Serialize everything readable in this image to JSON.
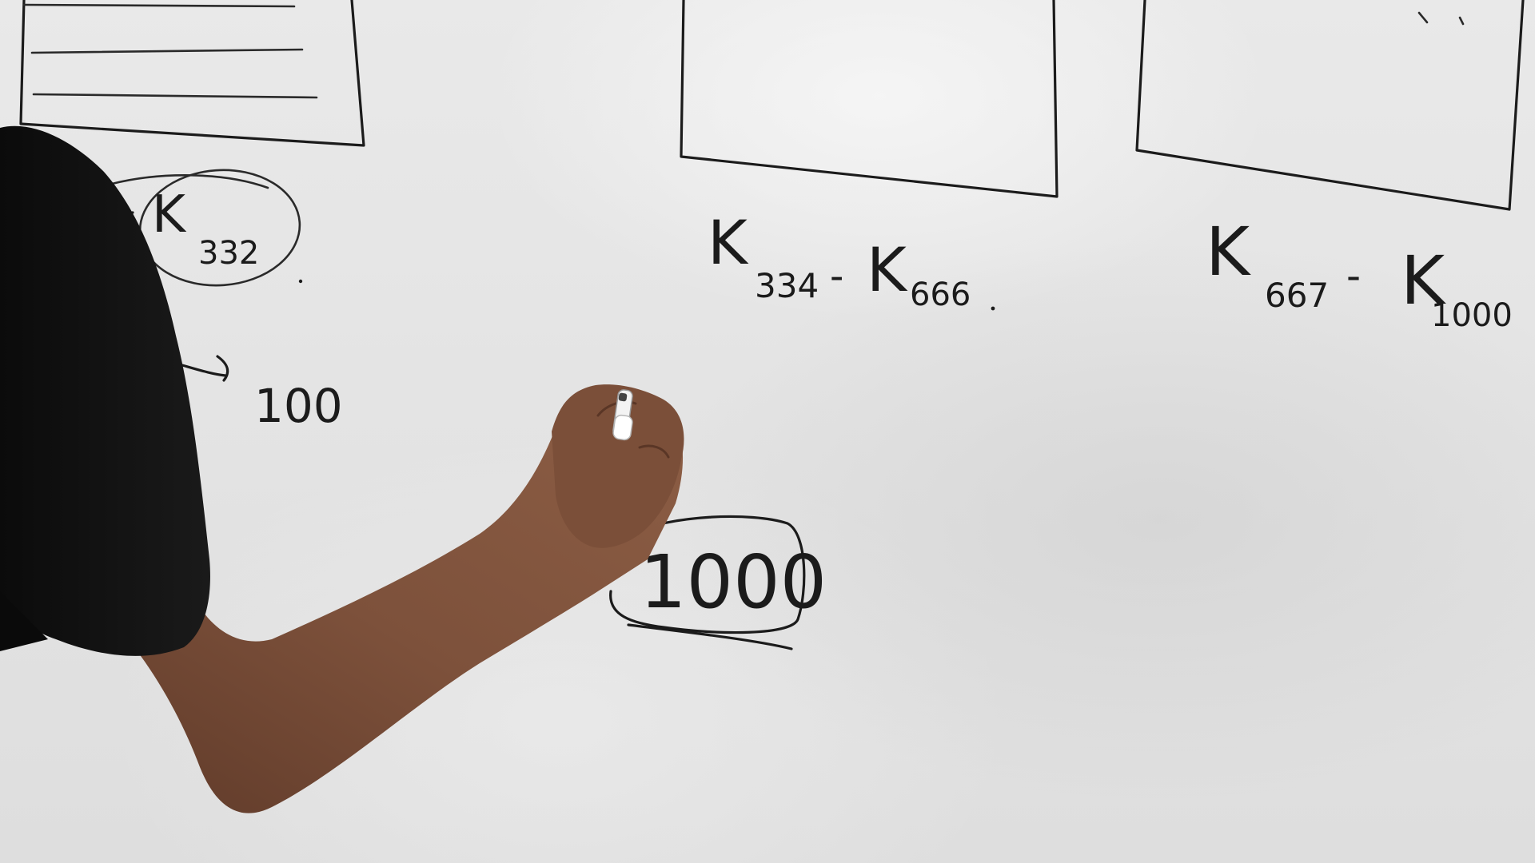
{
  "scene": {
    "description_free": true,
    "colors": {
      "ink": "#1b1b1b",
      "board": "#e6e6e6",
      "shirt": "#121212",
      "skin": "#7a4f3a",
      "marker_cap": "#f2f2f2"
    }
  },
  "whiteboard": {
    "labels": {
      "range1_main": "K",
      "range1_sub": "332",
      "range2_start_main": "K",
      "range2_start_sub": "334",
      "range2_dash": "-",
      "range2_end_main": "K",
      "range2_end_sub": "666",
      "range3_start_main": "K",
      "range3_start_sub": "667",
      "range3_dash": "-",
      "range3_end_main": "K",
      "range3_end_sub": "1000",
      "arrow_value": "100",
      "circled_total": "1000"
    }
  },
  "icons": {
    "marker": "marker-icon"
  }
}
